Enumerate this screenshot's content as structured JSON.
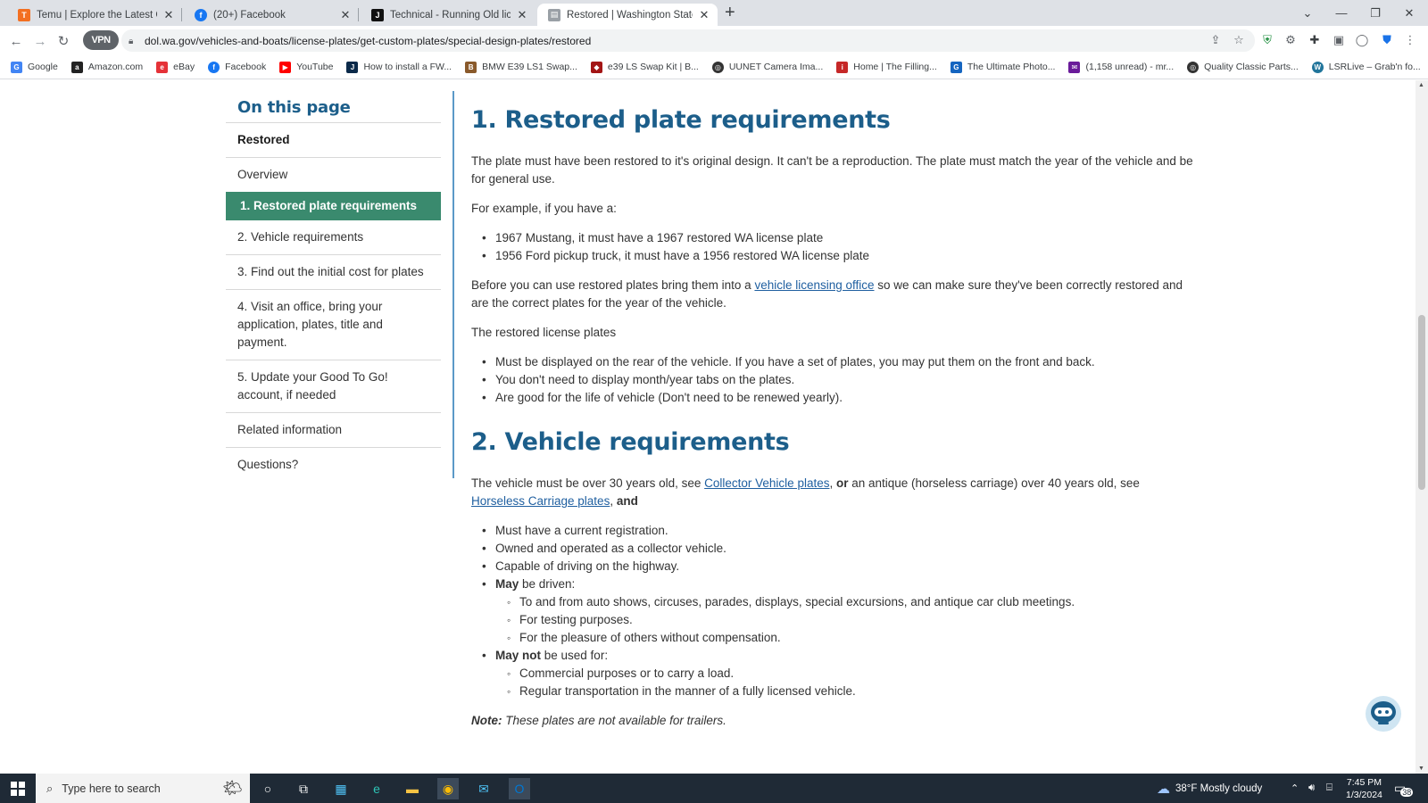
{
  "colors": {
    "toc_active": "#3a8a6e",
    "heading": "#1c5e8a",
    "link": "#1f5fa0"
  },
  "browser": {
    "tabs": [
      {
        "title": "Temu | Explore the Latest Clothing",
        "icon": "temu-icon"
      },
      {
        "title": "(20+) Facebook",
        "icon": "facebook-icon"
      },
      {
        "title": "Technical - Running Old license",
        "icon": "forum-icon"
      },
      {
        "title": "Restored | Washington State De",
        "icon": "dol-icon"
      }
    ],
    "vpn_label": "VPN",
    "url": "dol.wa.gov/vehicles-and-boats/license-plates/get-custom-plates/special-design-plates/restored",
    "bookmarks": [
      {
        "label": "Google"
      },
      {
        "label": "Amazon.com"
      },
      {
        "label": "eBay"
      },
      {
        "label": "Facebook"
      },
      {
        "label": "YouTube"
      },
      {
        "label": "How to install a FW..."
      },
      {
        "label": "BMW E39 LS1 Swap..."
      },
      {
        "label": "e39 LS Swap Kit | B..."
      },
      {
        "label": "UUNET Camera Ima..."
      },
      {
        "label": "Home | The Filling..."
      },
      {
        "label": "The Ultimate Photo..."
      },
      {
        "label": "(1,158 unread) - mr..."
      },
      {
        "label": "Quality Classic Parts..."
      },
      {
        "label": "LSRLive – Grab'n fo..."
      }
    ]
  },
  "toc": {
    "title": "On this page",
    "items": [
      "Restored",
      "Overview",
      "1. Restored plate requirements",
      "2. Vehicle requirements",
      "3. Find out the initial cost for plates",
      "4. Visit an office, bring your application, plates, title and payment.",
      "5. Update your Good To Go! account, if needed",
      "Related information",
      "Questions?"
    ]
  },
  "section1": {
    "heading": "1. Restored plate requirements",
    "p1": "The plate must have been restored to it's original design. It can't be a reproduction. The plate must match the year of the vehicle and be for general use.",
    "p2": "For example, if you have a:",
    "examples": [
      "1967 Mustang, it must have a 1967 restored WA license plate",
      "1956 Ford pickup truck, it must have a 1956 restored WA license plate"
    ],
    "p3_before": "Before you can use restored plates bring them into a ",
    "p3_link": "vehicle licensing office",
    "p3_after": " so we can make sure they've been correctly restored and are the correct plates for the year of the vehicle.",
    "p4": "The restored license plates",
    "plate_rules": [
      "Must be displayed on the rear of the vehicle. If you have a set of plates, you may put them on the front and back.",
      "You don't need to display month/year tabs on the plates.",
      "Are good for the life of vehicle (Don't need to be renewed yearly)."
    ]
  },
  "section2": {
    "heading": "2. Vehicle requirements",
    "p1_a": "The vehicle must be over 30 years old, see ",
    "p1_link1": "Collector Vehicle plates",
    "p1_b": ", ",
    "p1_or": "or",
    "p1_c": " an antique (horseless carriage) over 40 years old, see ",
    "p1_link2": "Horseless Carriage plates",
    "p1_d": ", ",
    "p1_and": "and",
    "rules": [
      "Must have a current registration.",
      "Owned and operated as a collector vehicle.",
      "Capable of driving on the highway."
    ],
    "may_bold": "May",
    "may_rest": " be driven:",
    "may_items": [
      "To and from auto shows, circuses, parades, displays, special excursions, and antique car club meetings.",
      "For testing purposes.",
      "For the pleasure of others without compensation."
    ],
    "maynot_bold": "May not",
    "maynot_rest": " be used for:",
    "maynot_items": [
      "Commercial purposes or to carry a load.",
      "Regular transportation in the manner of a fully licensed vehicle."
    ],
    "note_bold": "Note:",
    "note_rest": " These plates are not available for trailers."
  },
  "taskbar": {
    "search_placeholder": "Type here to search",
    "weather": "38°F  Mostly cloudy",
    "time": "7:45 PM",
    "date": "1/3/2024",
    "notifications": "38"
  }
}
